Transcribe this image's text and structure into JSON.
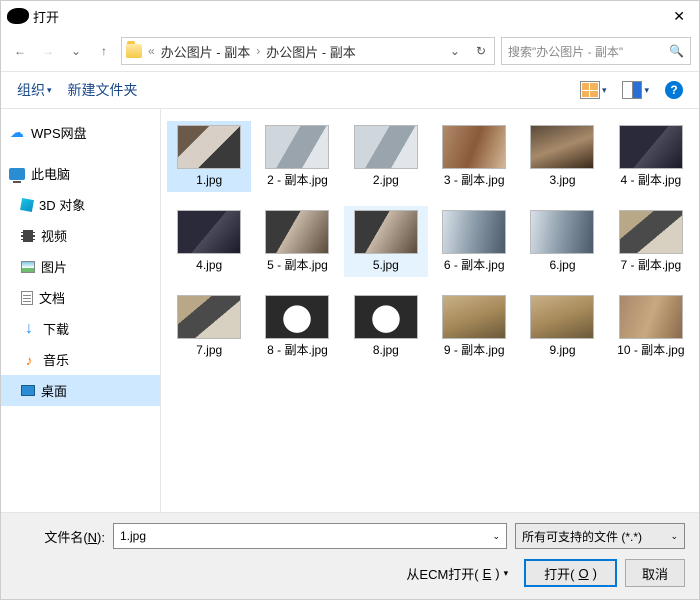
{
  "window": {
    "title": "打开"
  },
  "toolbar": {
    "organize": "组织",
    "new_folder": "新建文件夹"
  },
  "breadcrumb": {
    "parts": [
      "办公图片 - 副本",
      "办公图片 - 副本"
    ]
  },
  "search": {
    "placeholder": "搜索\"办公图片 - 副本\""
  },
  "sidebar": {
    "items": [
      {
        "label": "WPS网盘",
        "icon": "cloud"
      },
      {
        "label": "此电脑",
        "icon": "pc"
      },
      {
        "label": "3D 对象",
        "icon": "cube"
      },
      {
        "label": "视频",
        "icon": "film"
      },
      {
        "label": "图片",
        "icon": "pic"
      },
      {
        "label": "文档",
        "icon": "doc"
      },
      {
        "label": "下载",
        "icon": "dl"
      },
      {
        "label": "音乐",
        "icon": "music"
      },
      {
        "label": "桌面",
        "icon": "desk",
        "selected": true
      }
    ]
  },
  "files": [
    {
      "name": "1.jpg",
      "selected": true,
      "thumb": "t1"
    },
    {
      "name": "2 - 副本.jpg",
      "thumb": "t2"
    },
    {
      "name": "2.jpg",
      "thumb": "t2"
    },
    {
      "name": "3 - 副本.jpg",
      "thumb": "t3"
    },
    {
      "name": "3.jpg",
      "thumb": "t4"
    },
    {
      "name": "4 - 副本.jpg",
      "thumb": "t5"
    },
    {
      "name": "4.jpg",
      "thumb": "t5"
    },
    {
      "name": "5 - 副本.jpg",
      "thumb": "t6"
    },
    {
      "name": "5.jpg",
      "thumb": "t6",
      "highlight": true
    },
    {
      "name": "6 - 副本.jpg",
      "thumb": "t7"
    },
    {
      "name": "6.jpg",
      "thumb": "t7"
    },
    {
      "name": "7 - 副本.jpg",
      "thumb": "t8"
    },
    {
      "name": "7.jpg",
      "thumb": "t8"
    },
    {
      "name": "8 - 副本.jpg",
      "thumb": "t9"
    },
    {
      "name": "8.jpg",
      "thumb": "t9"
    },
    {
      "name": "9 - 副本.jpg",
      "thumb": "t10"
    },
    {
      "name": "9.jpg",
      "thumb": "t10"
    },
    {
      "name": "10 - 副本.jpg",
      "thumb": "t11"
    }
  ],
  "footer": {
    "filename_label": "文件名(N):",
    "filename_value": "1.jpg",
    "filter": "所有可支持的文件 (*.*)",
    "ecm_open": "从ECM打开(E)",
    "open": "打开(O)",
    "cancel": "取消"
  }
}
